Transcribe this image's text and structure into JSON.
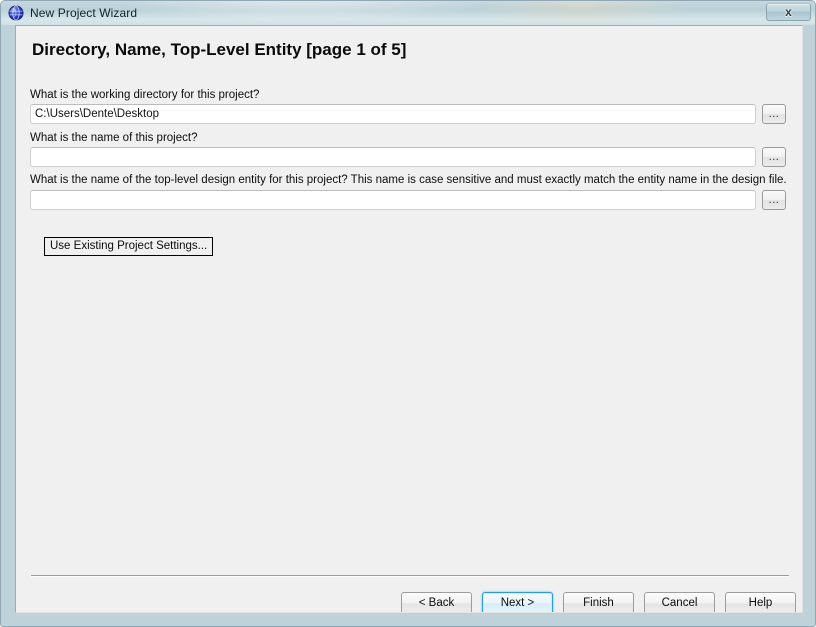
{
  "window": {
    "title": "New Project Wizard",
    "icon": "quartus-globe-icon",
    "close_label": "x"
  },
  "page": {
    "title": "Directory, Name, Top-Level Entity [page 1 of 5]"
  },
  "fields": [
    {
      "label": "What is the working directory for this project?",
      "value": "C:\\Users\\Dente\\Desktop",
      "placeholder": "",
      "browse_label": "..."
    },
    {
      "label": "What is the name of this project?",
      "value": "",
      "placeholder": "",
      "browse_label": "..."
    },
    {
      "label": "What is the name of the top-level design entity for this project? This name is case sensitive and must exactly match the entity name in the design file.",
      "value": "",
      "placeholder": "",
      "browse_label": "..."
    }
  ],
  "use_existing_button": {
    "label": "Use Existing Project Settings..."
  },
  "footer": {
    "buttons": [
      {
        "label": "< Back",
        "default": false
      },
      {
        "label": "Next >",
        "default": true
      },
      {
        "label": "Finish",
        "default": false
      },
      {
        "label": "Cancel",
        "default": false
      },
      {
        "label": "Help",
        "default": false
      }
    ]
  },
  "colors": {
    "accent": "#2e9ad6",
    "dialog_background": "#f0f0f0",
    "titlebar_top": "#9fbcc7",
    "titlebar_bottom": "#cfe0e4",
    "field_background": "#ffffff"
  }
}
